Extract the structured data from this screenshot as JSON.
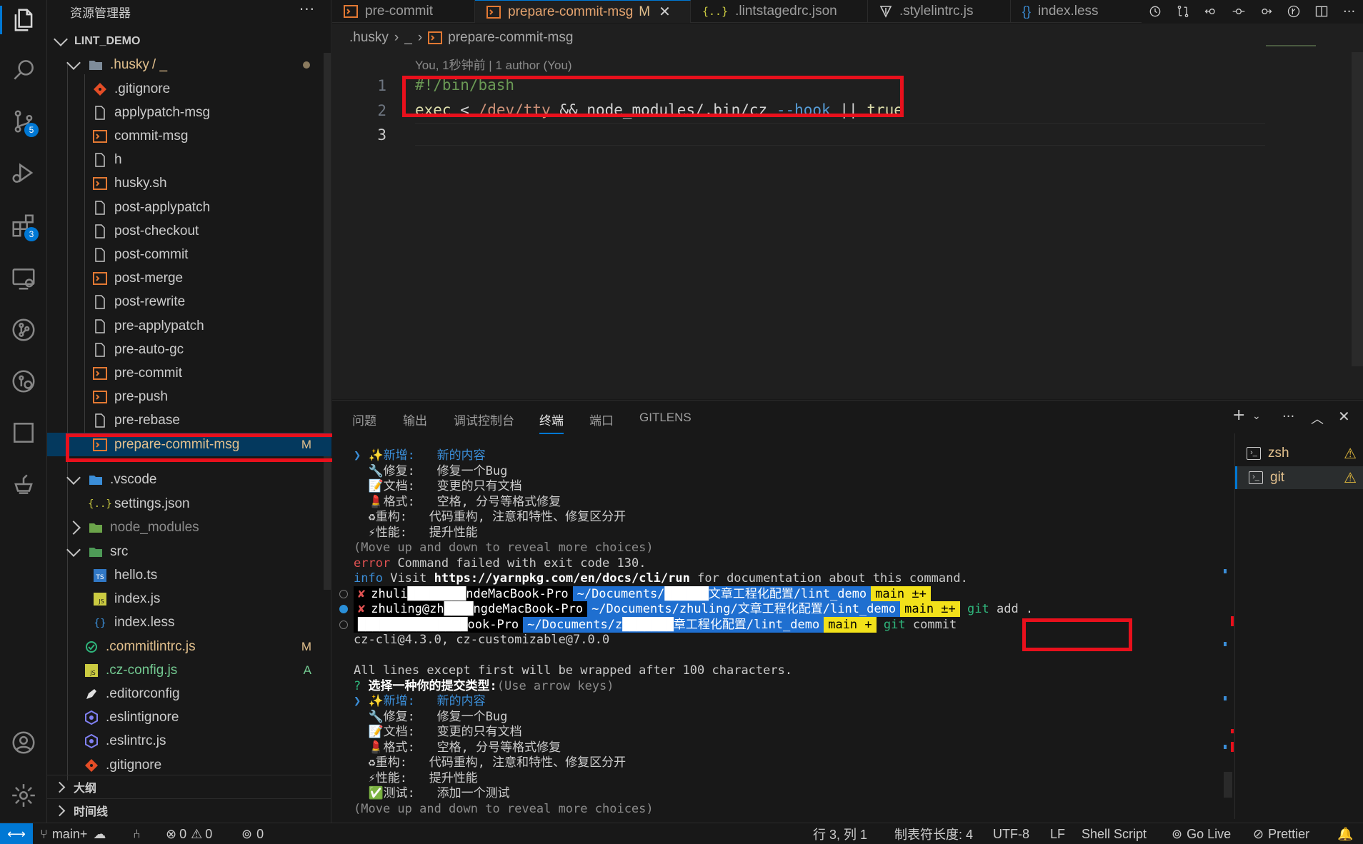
{
  "theme": {
    "accent": "#0078d4",
    "highlight": "#e8101c",
    "modified": "#e2c08d",
    "added": "#73c991"
  },
  "activity_bar": {
    "items": [
      {
        "icon": "files-icon"
      },
      {
        "icon": "search-icon"
      },
      {
        "icon": "source-control-icon",
        "badge": "5"
      },
      {
        "icon": "run-debug-icon"
      },
      {
        "icon": "extensions-icon",
        "badge": "3"
      },
      {
        "icon": "remote-explorer-icon"
      },
      {
        "icon": "git-graph-icon"
      },
      {
        "icon": "gitlens-icon"
      },
      {
        "icon": "square-icon"
      },
      {
        "icon": "teapot-icon"
      }
    ],
    "bottom": [
      {
        "icon": "account-icon"
      },
      {
        "icon": "gear-icon"
      }
    ]
  },
  "sidebar": {
    "title": "资源管理器",
    "more": "···",
    "workspace": "LINT_DEMO",
    "husky_folder": ".husky",
    "husky_sub": "/ _",
    "husky_files": [
      {
        "name": ".gitignore",
        "icon": "git"
      },
      {
        "name": "applypatch-msg",
        "icon": "file"
      },
      {
        "name": "commit-msg",
        "icon": "shell"
      },
      {
        "name": "h",
        "icon": "file"
      },
      {
        "name": "husky.sh",
        "icon": "shell"
      },
      {
        "name": "post-applypatch",
        "icon": "file"
      },
      {
        "name": "post-checkout",
        "icon": "file"
      },
      {
        "name": "post-commit",
        "icon": "file"
      },
      {
        "name": "post-merge",
        "icon": "shell"
      },
      {
        "name": "post-rewrite",
        "icon": "file"
      },
      {
        "name": "pre-applypatch",
        "icon": "file"
      },
      {
        "name": "pre-auto-gc",
        "icon": "file"
      },
      {
        "name": "pre-commit",
        "icon": "shell"
      },
      {
        "name": "pre-push",
        "icon": "shell"
      },
      {
        "name": "pre-rebase",
        "icon": "file"
      },
      {
        "name": "prepare-commit-msg",
        "icon": "shell",
        "decoration": "M"
      }
    ],
    "vscode_folder": ".vscode",
    "settings_json": "settings.json",
    "node_modules": "node_modules",
    "src_folder": "src",
    "src_files": [
      {
        "name": "hello.ts",
        "icon": "ts"
      },
      {
        "name": "index.js",
        "icon": "js"
      },
      {
        "name": "index.less",
        "icon": "less"
      }
    ],
    "root_files": [
      {
        "name": ".commitlintrc.js",
        "icon": "commitlint",
        "decoration": "M"
      },
      {
        "name": ".cz-config.js",
        "icon": "js",
        "decoration": "A"
      },
      {
        "name": ".editorconfig",
        "icon": "editorconfig"
      },
      {
        "name": ".eslintignore",
        "icon": "eslint"
      },
      {
        "name": ".eslintrc.js",
        "icon": "eslint"
      },
      {
        "name": ".gitignore",
        "icon": "git"
      }
    ],
    "outline": "大纲",
    "timeline": "时间线"
  },
  "tabs": [
    {
      "label": "pre-commit"
    },
    {
      "label": "prepare-commit-msg",
      "modified": "M",
      "close": "✕"
    },
    {
      "label": ".lintstagedrc.json"
    },
    {
      "label": ".stylelintrc.js"
    },
    {
      "label": "index.less"
    }
  ],
  "breadcrumb": [
    ".husky",
    "_",
    "prepare-commit-msg"
  ],
  "blame": "You, 1秒钟前 | 1 author (You)",
  "editor": {
    "line_numbers": [
      "1",
      "2",
      "3"
    ],
    "line1": "#!/bin/bash",
    "line2": {
      "kw": "exec",
      "lt": "<",
      "path": "/dev/tty",
      "and": "&&",
      "cmd": "node_modules/.bin/cz",
      "flag": "--hook",
      "or": "||",
      "val": "true"
    }
  },
  "panel": {
    "tabs": [
      "问题",
      "输出",
      "调试控制台",
      "终端",
      "端口",
      "GITLENS"
    ],
    "active_tab": "终端",
    "terminals": [
      {
        "name": "zsh",
        "warn": "⚠"
      },
      {
        "name": "git",
        "warn": "⚠"
      }
    ]
  },
  "terminal": {
    "choices_1": [
      {
        "mark": "❯",
        "emoji": "✨",
        "type": "新增:",
        "desc": "新的内容",
        "selected": true
      },
      {
        "emoji": "🔧",
        "type": "修复:",
        "desc": "修复一个Bug"
      },
      {
        "emoji": "📝",
        "type": "文档:",
        "desc": "变更的只有文档"
      },
      {
        "emoji": "💄",
        "type": "格式:",
        "desc": "空格, 分号等格式修复"
      },
      {
        "emoji": "♻",
        "type": "重构:",
        "desc": "代码重构, 注意和特性、修复区分开"
      },
      {
        "emoji": "⚡",
        "type": "性能:",
        "desc": "提升性能"
      }
    ],
    "hint": "(Move up and down to reveal more choices)",
    "error_label": "error",
    "error_msg": "Command failed with exit code 130.",
    "info_label": "info",
    "info_visit": "Visit",
    "info_url": "https://yarnpkg.com/en/docs/cli/run",
    "info_rest": "for documentation about this command.",
    "prompts": [
      {
        "status": "✘",
        "user": "zhuli████████ndeMacBook-Pro",
        "path": "~/Documents/██████文章工程化配置/lint_demo",
        "branch": "main ±+",
        "cmd": ""
      },
      {
        "status": "✘",
        "user": "zhuling@zh████ngdeMacBook-Pro",
        "path": "~/Documents/zhuling/文章工程化配置/lint_demo",
        "branch": "main ±+",
        "cmd_git": "git",
        "cmd_rest": "add ."
      },
      {
        "status": "",
        "user": "███████████████ook-Pro",
        "path": "~/Documents/z███████章工程化配置/lint_demo",
        "branch": "main +",
        "cmd_git": "git",
        "cmd_rest": "commit"
      }
    ],
    "version": "cz-cli@4.3.0, cz-customizable@7.0.0",
    "wrap_note": "All lines except first will be wrapped after 100 characters.",
    "question_mark": "?",
    "question": "选择一种你的提交类型:",
    "question_hint": "(Use arrow keys)",
    "choices_2": [
      {
        "mark": "❯",
        "emoji": "✨",
        "type": "新增:",
        "desc": "新的内容",
        "selected": true
      },
      {
        "emoji": "🔧",
        "type": "修复:",
        "desc": "修复一个Bug"
      },
      {
        "emoji": "📝",
        "type": "文档:",
        "desc": "变更的只有文档"
      },
      {
        "emoji": "💄",
        "type": "格式:",
        "desc": "空格, 分号等格式修复"
      },
      {
        "emoji": "♻",
        "type": "重构:",
        "desc": "代码重构, 注意和特性、修复区分开"
      },
      {
        "emoji": "⚡",
        "type": "性能:",
        "desc": "提升性能"
      },
      {
        "emoji": "✅",
        "type": "测试:",
        "desc": "添加一个测试"
      }
    ],
    "hint2": "(Move up and down to reveal more choices)"
  },
  "status": {
    "branch": "main+",
    "errors": "0",
    "warnings": "0",
    "ports": "0",
    "position": "行 3, 列 1",
    "tab_size": "制表符长度: 4",
    "encoding": "UTF-8",
    "eol": "LF",
    "language": "Shell Script",
    "go_live": "Go Live",
    "prettier": "Prettier"
  }
}
